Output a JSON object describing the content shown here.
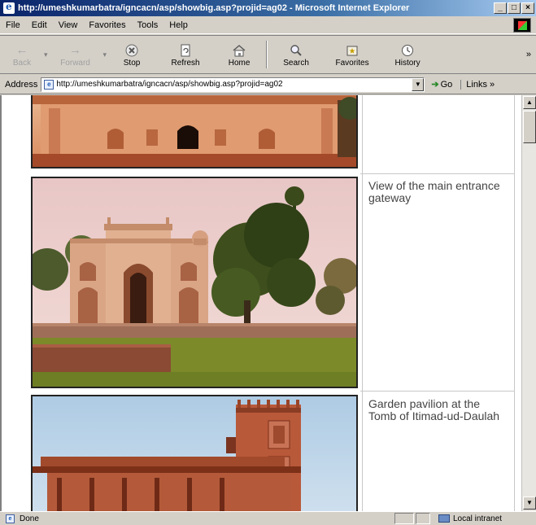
{
  "window": {
    "title": "http://umeshkumarbatra/igncacn/asp/showbig.asp?projid=ag02 - Microsoft Internet Explorer",
    "min": "_",
    "max": "□",
    "close": "×"
  },
  "menu": {
    "file": "File",
    "edit": "Edit",
    "view": "View",
    "favorites": "Favorites",
    "tools": "Tools",
    "help": "Help"
  },
  "toolbar": {
    "back": "Back",
    "forward": "Forward",
    "stop": "Stop",
    "refresh": "Refresh",
    "home": "Home",
    "search": "Search",
    "favorites": "Favorites",
    "history": "History",
    "more": "»"
  },
  "address": {
    "label": "Address",
    "url": "http://umeshkumarbatra/igncacn/asp/showbig.asp?projid=ag02",
    "go": "Go",
    "links": "Links »"
  },
  "content": {
    "captions": [
      "",
      "View of the main entrance gateway",
      "Garden pavilion at the Tomb of Itimad-ud-Daulah"
    ]
  },
  "status": {
    "text": "Done",
    "zone": "Local intranet"
  }
}
